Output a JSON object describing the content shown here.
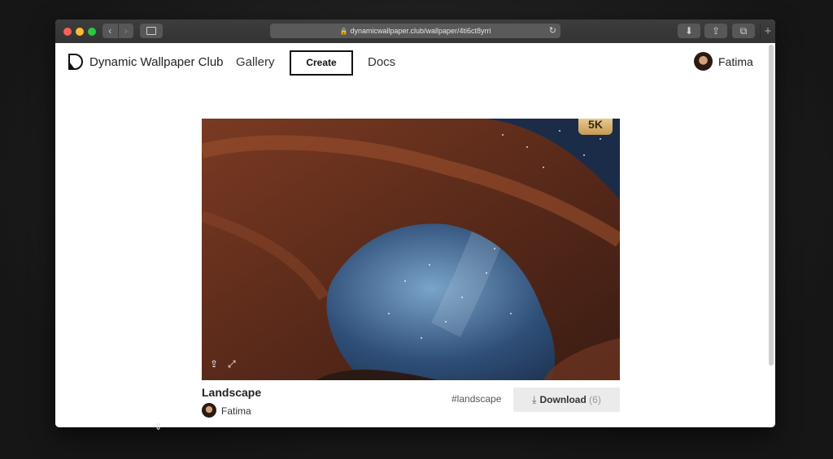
{
  "browser": {
    "url": "dynamicwallpaper.club/wallpaper/4ti6ct8yrri",
    "icons": {
      "back": "chevron-left-icon",
      "forward": "chevron-right-icon",
      "reload": "reload-icon",
      "downloads": "download-icon",
      "share": "share-icon",
      "tabs": "tabs-icon",
      "new_tab": "plus-icon"
    }
  },
  "site": {
    "brand": "Dynamic Wallpaper Club",
    "nav": {
      "gallery": "Gallery",
      "create": "Create",
      "docs": "Docs"
    },
    "user": {
      "name": "Fatima"
    }
  },
  "wallpaper": {
    "badge": "5K",
    "title": "Landscape",
    "author": "Fatima",
    "tag": "#landscape",
    "download_label": "Download",
    "download_count": "(6)"
  },
  "colors": {
    "badge_gold": "#d8b26e",
    "button_bg": "#ebebeb"
  }
}
